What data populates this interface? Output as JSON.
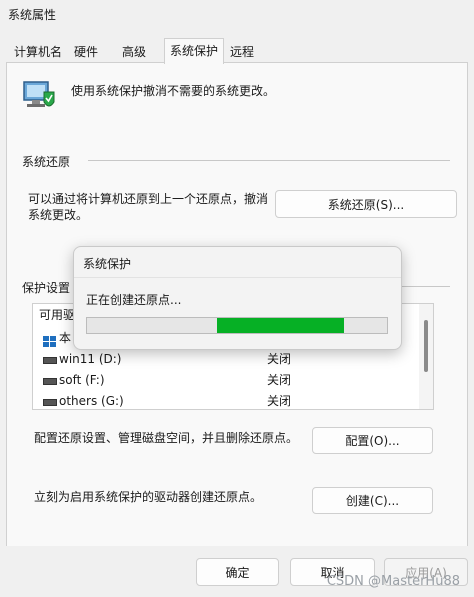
{
  "window": {
    "title": "系统属性"
  },
  "tabs": [
    "计算机名",
    "硬件",
    "高级",
    "系统保护",
    "远程"
  ],
  "description": "使用系统保护撤消不需要的系统更改。",
  "restore": {
    "heading": "系统还原",
    "text_line1": "可以通过将计算机还原到上一个还原点，撤消",
    "text_line2": "系统更改。",
    "button": "系统还原(S)..."
  },
  "protection": {
    "heading": "保护设置",
    "list_header_partial": "可用驱",
    "drives": [
      {
        "name_partial": "本",
        "status": "",
        "icon": "system-drive-icon"
      },
      {
        "name": "win11 (D:)",
        "status": "关闭",
        "icon": "drive-icon"
      },
      {
        "name": "soft (F:)",
        "status": "关闭",
        "icon": "drive-icon"
      },
      {
        "name": "others (G:)",
        "status": "关闭",
        "icon": "drive-icon"
      }
    ],
    "configure_text": "配置还原设置、管理磁盘空间，并且删除还原点。",
    "configure_button": "配置(O)...",
    "create_text": "立刻为启用系统保护的驱动器创建还原点。",
    "create_button": "创建(C)..."
  },
  "dialog": {
    "title": "系统保护",
    "message": "正在创建还原点...",
    "progress_color": "#06b025"
  },
  "footer": {
    "ok": "确定",
    "cancel": "取消",
    "apply": "应用(A)"
  },
  "watermark": "CSDN @MasterHu88"
}
